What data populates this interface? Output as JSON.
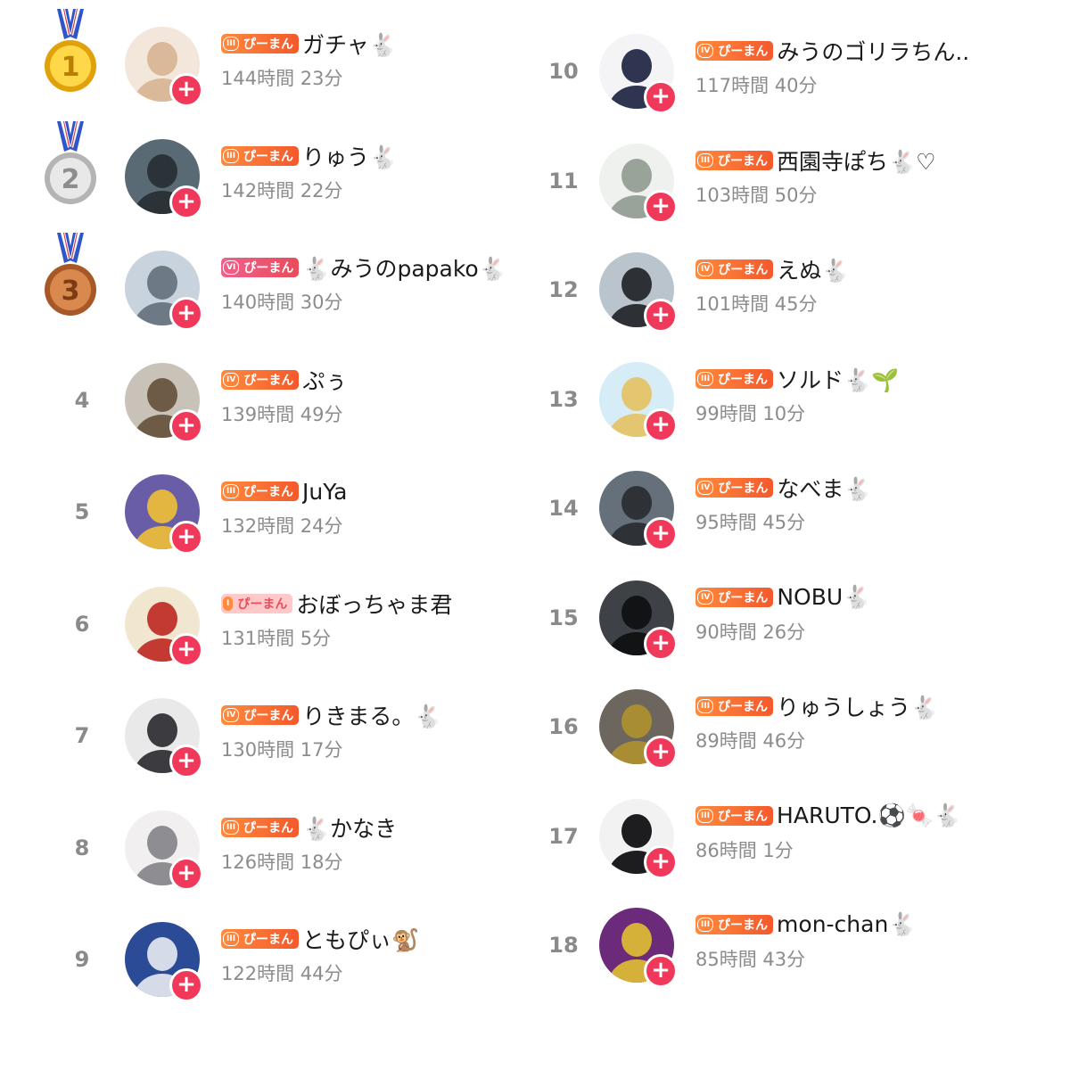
{
  "badge_label": "ぴーまん",
  "follow_icon": "+",
  "colors": {
    "follow": "#f0385a",
    "badge": "#f4592c",
    "rank": "#8a8a8a"
  },
  "ranking": [
    {
      "rank": "1",
      "level": "III",
      "name": "ガチャ🐇",
      "time": "144時間 23分"
    },
    {
      "rank": "2",
      "level": "III",
      "name": "りゅう🐇",
      "time": "142時間 22分"
    },
    {
      "rank": "3",
      "level": "VI",
      "name": "🐇みうのpapako🐇",
      "time": "140時間 30分"
    },
    {
      "rank": "4",
      "level": "IV",
      "name": "ぷぅ",
      "time": "139時間 49分"
    },
    {
      "rank": "5",
      "level": "III",
      "name": "JuYa",
      "time": "132時間 24分"
    },
    {
      "rank": "6",
      "level": "I",
      "name": "おぼっちゃま君",
      "time": "131時間 5分"
    },
    {
      "rank": "7",
      "level": "IV",
      "name": "りきまる。🐇",
      "time": "130時間 17分"
    },
    {
      "rank": "8",
      "level": "III",
      "name": "🐇かなき",
      "time": "126時間 18分"
    },
    {
      "rank": "9",
      "level": "III",
      "name": "ともぴぃ🐒",
      "time": "122時間 44分"
    },
    {
      "rank": "10",
      "level": "IV",
      "name": "みうのゴリラちん..",
      "time": "117時間 40分"
    },
    {
      "rank": "11",
      "level": "III",
      "name": "西園寺ぽち🐇♡",
      "time": "103時間 50分"
    },
    {
      "rank": "12",
      "level": "IV",
      "name": "えぬ🐇",
      "time": "101時間 45分"
    },
    {
      "rank": "13",
      "level": "III",
      "name": "ソルド🐇🌱",
      "time": "99時間 10分"
    },
    {
      "rank": "14",
      "level": "IV",
      "name": "なべま🐇",
      "time": "95時間 45分"
    },
    {
      "rank": "15",
      "level": "IV",
      "name": "NOBU🐇",
      "time": "90時間 26分"
    },
    {
      "rank": "16",
      "level": "III",
      "name": "りゅうしょう🐇",
      "time": "89時間 46分"
    },
    {
      "rank": "17",
      "level": "III",
      "name": "HARUTO.⚽🍬🐇",
      "time": "86時間 1分"
    },
    {
      "rank": "18",
      "level": "III",
      "name": "mon-chan🐇",
      "time": "85時間 43分"
    }
  ]
}
